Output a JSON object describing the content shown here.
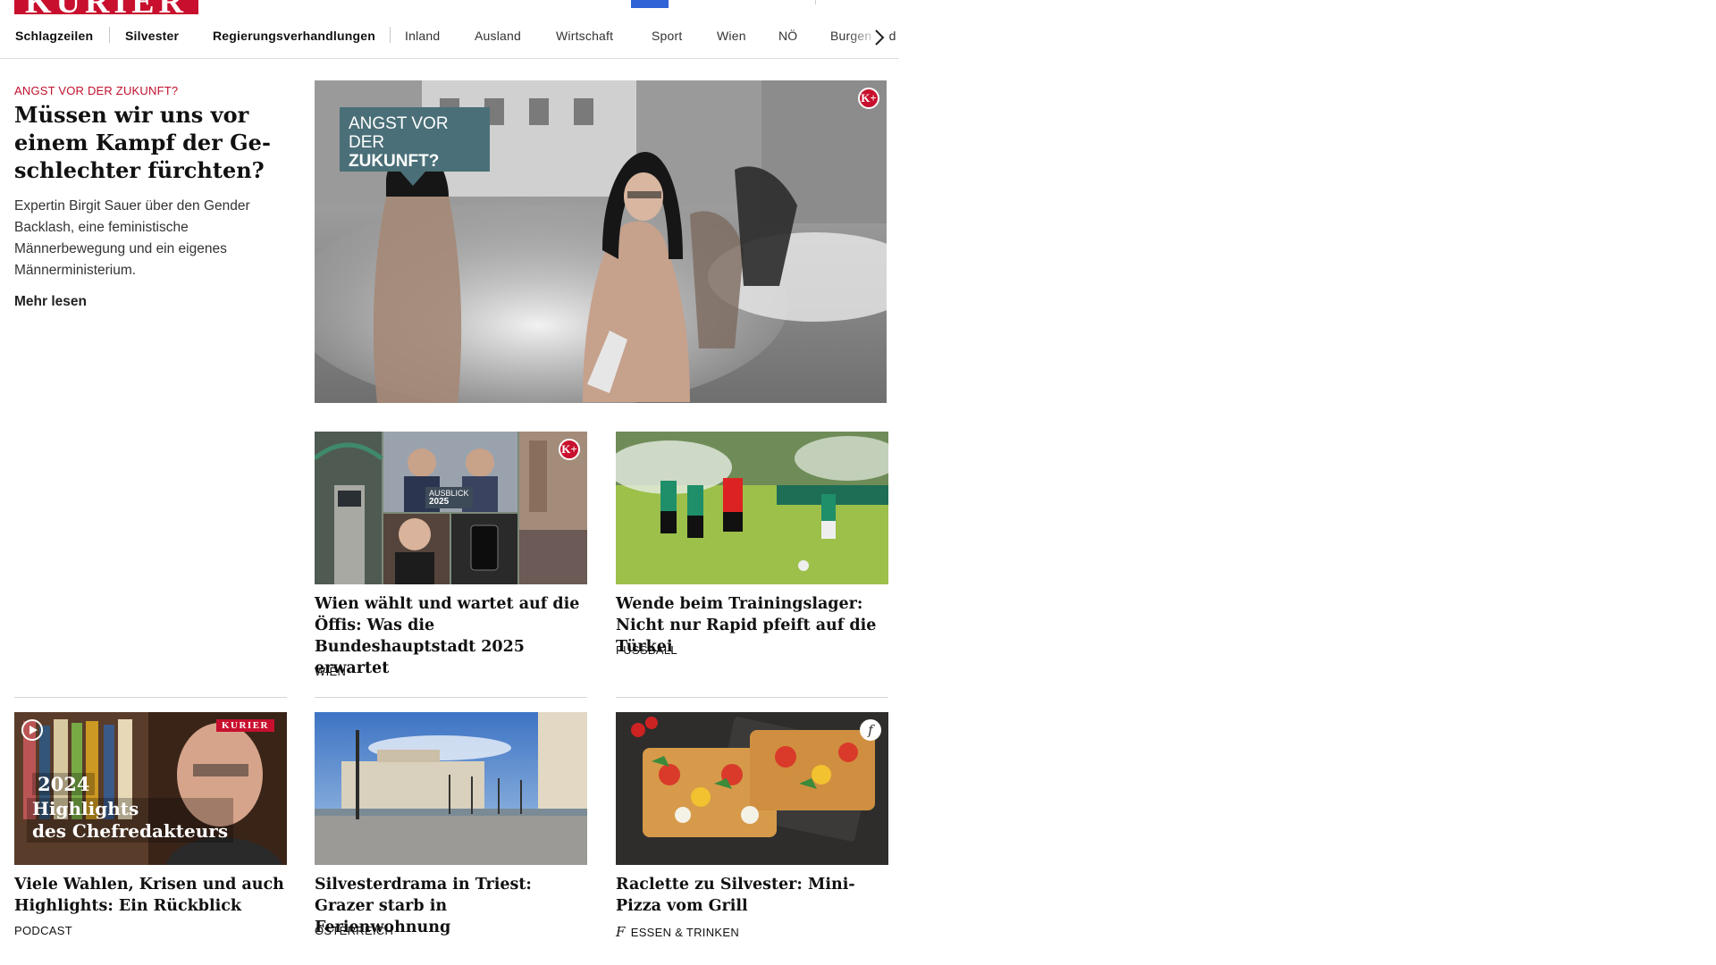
{
  "header": {
    "logo_text": "KURIER",
    "brand_color": "#c8102e"
  },
  "nav": {
    "items": [
      {
        "label": "Schlagzeilen"
      },
      {
        "label": "Silvester"
      },
      {
        "label": "Regierungsverhandlungen"
      },
      {
        "label": "Inland"
      },
      {
        "label": "Ausland"
      },
      {
        "label": "Wirtschaft"
      },
      {
        "label": "Sport"
      },
      {
        "label": "Wien"
      },
      {
        "label": "NÖ"
      },
      {
        "label": "Burgenland"
      }
    ],
    "next_icon": "chevron-right-icon"
  },
  "lead": {
    "kicker": "ANGST VOR DER ZUKUNFT?",
    "title": "Müssen wir uns vor ei­nem Kampf der Ge­schlechter fürchten?",
    "teaser": "Expertin Birgit Sauer über den Gender Backlash, eine feministische Männerbewegung und ein eigenes Männerministerium.",
    "more_label": "Mehr lesen",
    "hero_overlay_line1": "ANGST VOR DER",
    "hero_overlay_line2": "ZUKUNFT?",
    "premium_badge": "K+"
  },
  "cards": [
    {
      "title": "Wien wählt und wartet auf die Öf­fis: Was die Bundeshauptstadt 2025 erwartet",
      "category": "WIEN",
      "premium_badge": "K+",
      "image_label_1": "AUSBLICK",
      "image_label_2": "2025"
    },
    {
      "title": "Wende beim Trainingslager: Nicht nur Rapid pfeift auf die Türkei",
      "category": "FUSSBALL"
    },
    {
      "title": "Viele Wahlen, Krisen und auch Highlights: Ein Rückblick",
      "category": "PODCAST",
      "image_brand": "KURIER",
      "image_year": "2024",
      "image_line1": "Highlights",
      "image_line2": "des Chefredakteurs"
    },
    {
      "title": "Silvesterdrama in Triest: Grazer starb in Ferienwohnung",
      "category": "ÖSTERREICH"
    },
    {
      "title": "Raclette zu Silvester: Mini-Pizza vom Grill",
      "category": "ESSEN & TRINKEN",
      "icon": "food-f-icon",
      "icon_glyph": "f"
    }
  ]
}
